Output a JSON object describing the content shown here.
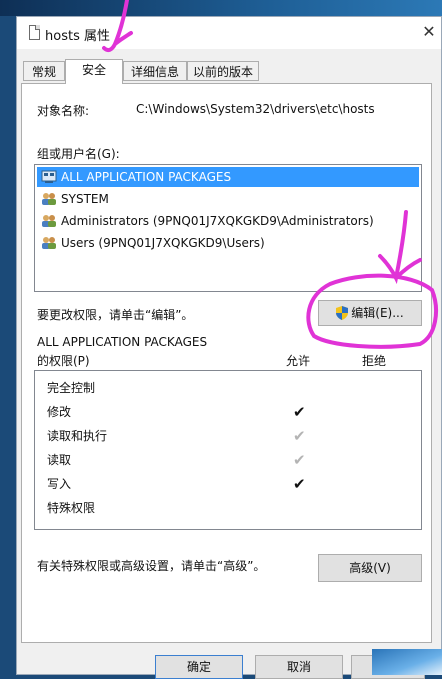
{
  "window": {
    "title": "hosts 属性",
    "close_glyph": "✕"
  },
  "tabs": [
    {
      "label": "常规"
    },
    {
      "label": "安全"
    },
    {
      "label": "详细信息"
    },
    {
      "label": "以前的版本"
    }
  ],
  "object": {
    "label": "对象名称:",
    "value": "C:\\Windows\\System32\\drivers\\etc\\hosts"
  },
  "groups": {
    "label": "组或用户名(G):",
    "items": [
      {
        "label": "ALL APPLICATION PACKAGES",
        "icon": "packages-icon"
      },
      {
        "label": "SYSTEM",
        "icon": "users-icon"
      },
      {
        "label": "Administrators (9PNQ01J7XQKGKD9\\Administrators)",
        "icon": "users-icon"
      },
      {
        "label": "Users (9PNQ01J7XQKGKD9\\Users)",
        "icon": "users-icon"
      }
    ]
  },
  "edit": {
    "hint": "要更改权限，请单击“编辑”。",
    "button": "编辑(E)...",
    "icon": "shield-icon"
  },
  "permissions": {
    "title_line1": "ALL APPLICATION PACKAGES",
    "title_line2": "的权限(P)",
    "allow_header": "允许",
    "deny_header": "拒绝",
    "rows": [
      {
        "name": "完全控制",
        "allow": ""
      },
      {
        "name": "修改",
        "allow": "✔"
      },
      {
        "name": "读取和执行",
        "allow": "✔"
      },
      {
        "name": "读取",
        "allow": "✔"
      },
      {
        "name": "写入",
        "allow": "✔"
      },
      {
        "name": "特殊权限",
        "allow": ""
      }
    ]
  },
  "advanced": {
    "hint": "有关特殊权限或高级设置，请单击“高级”。",
    "button": "高级(V)"
  },
  "footer": {
    "ok": "确定",
    "cancel": "取消"
  },
  "colors": {
    "selection": "#3399ff",
    "annotation": "#e033d6"
  }
}
